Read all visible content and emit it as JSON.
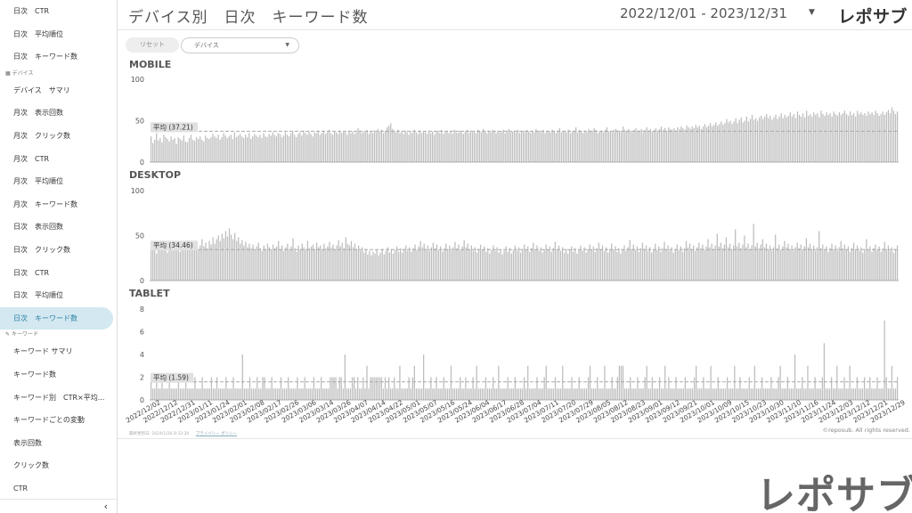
{
  "header": {
    "title": "デバイス別　日次　キーワード数",
    "date_range": "2022/12/01 - 2023/12/31",
    "brand": "レポサブ"
  },
  "filters": {
    "reset_label": "リセット",
    "device_label": "デバイス"
  },
  "sidebar": {
    "top_items": [
      "日次　CTR",
      "日次　平均順位",
      "日次　キーワード数"
    ],
    "device_section": "デバイス",
    "device_items": [
      "デバイス　サマリ",
      "月次　表示回数",
      "月次　クリック数",
      "月次　CTR",
      "月次　平均順位",
      "月次　キーワード数",
      "日次　表示回数",
      "日次　クリック数",
      "日次　CTR",
      "日次　平均順位",
      "日次　キーワード数"
    ],
    "keyword_section": "キーワード",
    "keyword_items": [
      "キーワード サマリ",
      "キーワード数",
      "キーワード別　CTR×平均...",
      "キーワードごとの変動",
      "表示回数",
      "クリック数",
      "CTR"
    ],
    "collapse_icon": "‹"
  },
  "footer": {
    "updated": "最終更新日: 2024/1/26 8:33:20",
    "privacy": "プライバシー ポリシー",
    "copyright": "©reposub. All rights reserved.",
    "big_logo": "レポサブ"
  },
  "colors": {
    "bar": "#bdbdbd",
    "bar_stroke": "#a8a8a8",
    "avg_line": "#aaaaaa",
    "active_bg": "#d3e8f0"
  },
  "chart_data": [
    {
      "type": "bar",
      "title": "MOBILE",
      "ylim": [
        0,
        100
      ],
      "yticks": [
        0,
        50,
        100
      ],
      "average_label": "平均 (37.21)",
      "average": 37.21,
      "start_date": "2022/12/01",
      "end_date": "2023/12/31",
      "values": [
        31,
        23,
        27,
        35,
        26,
        29,
        24,
        33,
        30,
        28,
        25,
        31,
        27,
        29,
        22,
        30,
        28,
        26,
        32,
        25,
        24,
        29,
        33,
        27,
        26,
        30,
        28,
        31,
        27,
        25,
        32,
        29,
        28,
        30,
        34,
        31,
        29,
        33,
        27,
        30,
        35,
        32,
        29,
        31,
        33,
        28,
        36,
        30,
        32,
        34,
        31,
        29,
        33,
        30,
        35,
        28,
        31,
        34,
        32,
        30,
        33,
        29,
        35,
        31,
        30,
        34,
        32,
        36,
        33,
        31,
        35,
        34,
        30,
        32,
        36,
        33,
        31,
        35,
        37,
        33,
        30,
        34,
        36,
        32,
        38,
        35,
        33,
        37,
        34,
        31,
        36,
        35,
        38,
        33,
        35,
        37,
        34,
        36,
        39,
        35,
        33,
        37,
        36,
        34,
        38,
        35,
        37,
        36,
        33,
        38,
        35,
        37,
        34,
        36,
        41,
        38,
        35,
        37,
        36,
        39,
        34,
        37,
        35,
        38,
        36,
        40,
        37,
        39,
        35,
        38,
        42,
        44,
        47,
        40,
        38,
        36,
        39,
        35,
        37,
        34,
        38,
        36,
        33,
        37,
        35,
        39,
        36,
        34,
        38,
        35,
        37,
        36,
        34,
        38,
        35,
        37,
        33,
        36,
        38,
        35,
        39,
        34,
        36,
        38,
        35,
        37,
        34,
        39,
        36,
        35,
        38,
        36,
        34,
        37,
        39,
        35,
        38,
        36,
        37,
        35,
        39,
        38,
        36,
        40,
        37,
        35,
        38,
        36,
        39,
        37,
        35,
        38,
        36,
        37,
        39,
        35,
        38,
        40,
        36,
        37,
        38,
        36,
        39,
        35,
        37,
        38,
        36,
        39,
        37,
        35,
        38,
        36,
        40,
        37,
        38,
        36,
        39,
        35,
        37,
        38,
        36,
        39,
        37,
        35,
        38,
        41,
        36,
        37,
        38,
        36,
        39,
        35,
        37,
        38,
        42,
        36,
        39,
        37,
        35,
        38,
        36,
        40,
        37,
        38,
        41,
        39,
        35,
        37,
        38,
        36,
        39,
        42,
        37,
        38,
        36,
        39,
        40,
        37,
        38,
        36,
        43,
        39,
        37,
        40,
        38,
        36,
        39,
        41,
        37,
        38,
        40,
        36,
        39,
        42,
        38,
        40,
        37,
        39,
        41,
        38,
        40,
        43,
        39,
        41,
        38,
        42,
        40,
        39,
        41,
        38,
        42,
        40,
        43,
        41,
        39,
        44,
        42,
        40,
        43,
        41,
        45,
        42,
        44,
        40,
        43,
        46,
        42,
        44,
        47,
        43,
        45,
        48,
        44,
        46,
        49,
        45,
        47,
        52,
        48,
        50,
        46,
        49,
        53,
        47,
        51,
        54,
        48,
        50,
        55,
        49,
        52,
        57,
        51,
        53,
        50,
        54,
        56,
        52,
        55,
        58,
        53,
        56,
        51,
        54,
        57,
        52,
        55,
        59,
        53,
        57,
        54,
        56,
        60,
        55,
        58,
        53,
        61,
        57,
        55,
        59,
        54,
        62,
        56,
        58,
        55,
        60,
        57,
        59,
        54,
        62,
        58,
        56,
        60,
        57,
        59,
        55,
        61,
        58,
        56,
        60,
        57,
        59,
        62,
        58,
        56,
        61,
        57,
        59,
        55,
        62,
        58,
        60,
        57,
        59,
        56,
        61,
        58,
        60,
        57,
        62,
        59,
        56,
        58,
        61,
        57,
        60,
        63,
        59,
        66,
        62,
        58,
        61
      ]
    },
    {
      "type": "bar",
      "title": "DESKTOP",
      "ylim": [
        0,
        100
      ],
      "yticks": [
        0,
        50,
        100
      ],
      "average_label": "平均 (34.46)",
      "average": 34.46,
      "start_date": "2022/12/01",
      "end_date": "2023/12/31",
      "values": [
        38,
        34,
        41,
        30,
        36,
        42,
        39,
        35,
        44,
        31,
        37,
        40,
        33,
        38,
        43,
        36,
        32,
        39,
        41,
        35,
        45,
        38,
        34,
        40,
        37,
        43,
        35,
        39,
        46,
        38,
        42,
        36,
        44,
        40,
        48,
        41,
        46,
        50,
        44,
        52,
        47,
        55,
        49,
        58,
        51,
        46,
        53,
        44,
        48,
        41,
        45,
        39,
        43,
        37,
        41,
        36,
        40,
        34,
        38,
        42,
        36,
        33,
        39,
        35,
        41,
        37,
        34,
        40,
        36,
        38,
        44,
        35,
        39,
        33,
        37,
        41,
        35,
        38,
        47,
        36,
        32,
        39,
        35,
        41,
        37,
        34,
        44,
        36,
        38,
        40,
        35,
        42,
        37,
        39,
        34,
        41,
        36,
        38,
        43,
        37,
        40,
        35,
        39,
        45,
        38,
        42,
        36,
        48,
        41,
        39,
        44,
        37,
        41,
        35,
        39,
        33,
        37,
        31,
        35,
        29,
        33,
        28,
        32,
        30,
        34,
        28,
        31,
        35,
        29,
        33,
        37,
        31,
        35,
        30,
        34,
        38,
        32,
        36,
        31,
        35,
        39,
        33,
        37,
        32,
        36,
        40,
        34,
        38,
        44,
        37,
        41,
        35,
        39,
        33,
        37,
        42,
        36,
        40,
        34,
        38,
        32,
        36,
        41,
        35,
        39,
        33,
        37,
        43,
        36,
        40,
        34,
        38,
        45,
        37,
        41,
        35,
        39,
        33,
        37,
        31,
        35,
        40,
        34,
        38,
        32,
        36,
        30,
        34,
        39,
        33,
        37,
        31,
        35,
        29,
        33,
        38,
        32,
        36,
        30,
        34,
        39,
        33,
        37,
        31,
        35,
        40,
        34,
        38,
        32,
        36,
        42,
        35,
        39,
        33,
        37,
        31,
        35,
        40,
        34,
        38,
        32,
        36,
        43,
        35,
        39,
        33,
        37,
        31,
        35,
        30,
        34,
        38,
        32,
        36,
        30,
        34,
        39,
        33,
        37,
        31,
        35,
        40,
        34,
        38,
        32,
        36,
        42,
        35,
        39,
        33,
        37,
        31,
        35,
        41,
        34,
        38,
        32,
        36,
        30,
        34,
        39,
        33,
        37,
        45,
        35,
        40,
        34,
        38,
        32,
        36,
        42,
        35,
        39,
        33,
        37,
        31,
        35,
        41,
        34,
        38,
        32,
        36,
        43,
        35,
        39,
        33,
        37,
        31,
        35,
        40,
        34,
        38,
        32,
        36,
        44,
        37,
        41,
        35,
        39,
        33,
        37,
        42,
        36,
        40,
        34,
        38,
        46,
        37,
        41,
        35,
        39,
        52,
        38,
        42,
        36,
        40,
        48,
        37,
        41,
        35,
        39,
        57,
        38,
        42,
        36,
        40,
        50,
        37,
        41,
        35,
        39,
        63,
        38,
        42,
        36,
        40,
        46,
        37,
        41,
        35,
        39,
        33,
        37,
        51,
        36,
        40,
        34,
        38,
        44,
        37,
        41,
        35,
        39,
        33,
        37,
        42,
        36,
        40,
        34,
        38,
        47,
        37,
        41,
        35,
        39,
        33,
        37,
        55,
        36,
        40,
        34,
        38,
        32,
        36,
        41,
        35,
        39,
        33,
        37,
        44,
        36,
        40,
        34,
        38,
        32,
        36,
        42,
        35,
        39,
        33,
        37,
        31,
        35,
        46,
        34,
        38,
        32,
        36,
        40,
        34,
        38,
        32,
        36,
        43,
        35,
        39,
        33,
        37,
        31,
        35,
        39
      ]
    },
    {
      "type": "bar",
      "title": "TABLET",
      "ylim": [
        0,
        8
      ],
      "yticks": [
        0,
        2,
        4,
        6,
        8
      ],
      "average_label": "平均 (1.59)",
      "average": 1.59,
      "start_date": "2022/12/01",
      "end_date": "2023/12/31",
      "values": [
        2,
        1,
        1,
        2,
        1,
        1,
        2,
        1,
        1,
        1,
        2,
        1,
        1,
        1,
        1,
        2,
        1,
        1,
        1,
        2,
        1,
        1,
        1,
        1,
        2,
        1,
        1,
        1,
        2,
        1,
        1,
        1,
        1,
        2,
        1,
        1,
        2,
        1,
        1,
        1,
        1,
        2,
        1,
        1,
        1,
        2,
        1,
        1,
        1,
        1,
        4,
        1,
        1,
        1,
        2,
        1,
        1,
        1,
        2,
        1,
        1,
        2,
        2,
        1,
        1,
        1,
        2,
        1,
        1,
        1,
        1,
        2,
        1,
        1,
        1,
        2,
        1,
        1,
        1,
        1,
        2,
        1,
        1,
        1,
        2,
        1,
        1,
        1,
        1,
        2,
        1,
        1,
        1,
        2,
        1,
        1,
        1,
        1,
        2,
        2,
        2,
        2,
        1,
        2,
        2,
        1,
        4,
        1,
        1,
        1,
        2,
        2,
        1,
        2,
        1,
        1,
        2,
        1,
        3,
        1,
        2,
        2,
        2,
        2,
        2,
        2,
        2,
        1,
        2,
        1,
        2,
        1,
        1,
        2,
        1,
        1,
        3,
        1,
        1,
        1,
        1,
        2,
        1,
        2,
        3,
        1,
        1,
        1,
        1,
        4,
        1,
        1,
        1,
        2,
        1,
        1,
        2,
        1,
        1,
        1,
        2,
        1,
        1,
        1,
        3,
        1,
        1,
        1,
        1,
        2,
        1,
        1,
        2,
        1,
        1,
        1,
        2,
        1,
        3,
        1,
        1,
        1,
        1,
        2,
        1,
        1,
        1,
        2,
        1,
        1,
        3,
        1,
        1,
        1,
        1,
        2,
        1,
        1,
        1,
        2,
        1,
        1,
        1,
        1,
        2,
        1,
        3,
        1,
        1,
        1,
        1,
        2,
        1,
        1,
        1,
        2,
        3,
        1,
        1,
        1,
        1,
        2,
        1,
        1,
        1,
        3,
        1,
        1,
        1,
        1,
        2,
        1,
        1,
        1,
        2,
        1,
        1,
        1,
        1,
        2,
        3,
        1,
        1,
        1,
        2,
        1,
        1,
        1,
        3,
        1,
        1,
        1,
        2,
        1,
        1,
        2,
        3,
        3,
        3,
        1,
        1,
        1,
        2,
        1,
        1,
        1,
        2,
        1,
        1,
        1,
        2,
        3,
        1,
        1,
        2,
        1,
        1,
        1,
        2,
        1,
        1,
        3,
        1,
        2,
        1,
        1,
        1,
        2,
        1,
        1,
        1,
        1,
        2,
        1,
        1,
        1,
        1,
        2,
        3,
        1,
        1,
        1,
        2,
        1,
        1,
        1,
        3,
        1,
        1,
        1,
        2,
        1,
        1,
        1,
        1,
        2,
        1,
        1,
        1,
        3,
        1,
        1,
        2,
        1,
        1,
        1,
        1,
        2,
        1,
        1,
        3,
        1,
        1,
        1,
        2,
        1,
        1,
        1,
        1,
        2,
        1,
        1,
        1,
        2,
        3,
        1,
        1,
        1,
        2,
        1,
        1,
        1,
        4,
        1,
        1,
        1,
        2,
        1,
        1,
        3,
        1,
        1,
        1,
        2,
        1,
        1,
        1,
        2,
        5,
        1,
        1,
        1,
        2,
        1,
        1,
        3,
        1,
        1,
        1,
        2,
        1,
        1,
        3,
        1,
        1,
        1,
        2,
        1,
        1,
        1,
        2,
        1,
        1,
        2,
        1,
        1,
        1,
        2,
        1,
        1,
        1,
        7,
        2,
        1,
        1,
        3,
        1,
        1,
        2
      ]
    }
  ],
  "x_axis": {
    "tick_labels": [
      "2022/12/02",
      "2022/12/12",
      "2022/12/31",
      "2023/01/11",
      "2023/01/24",
      "2023/02/01",
      "2023/02/08",
      "2023/02/17",
      "2023/02/26",
      "2023/03/06",
      "2023/03/14",
      "2023/03/26",
      "2023/04/07",
      "2023/04/14",
      "2023/04/22",
      "2023/05/01",
      "2023/05/07",
      "2023/05/16",
      "2023/05/24",
      "2023/06/04",
      "2023/06/17",
      "2023/06/28",
      "2023/07/04",
      "2023/07/11",
      "2023/07/20",
      "2023/07/29",
      "2023/08/05",
      "2023/08/12",
      "2023/08/23",
      "2023/09/01",
      "2023/09/12",
      "2023/09/21",
      "2023/10/01",
      "2023/10/09",
      "2023/10/15",
      "2023/10/23",
      "2023/10/30",
      "2023/11/10",
      "2023/11/16",
      "2023/11/24",
      "2023/12/03",
      "2023/12/12",
      "2023/12/21",
      "2023/12/29"
    ]
  }
}
